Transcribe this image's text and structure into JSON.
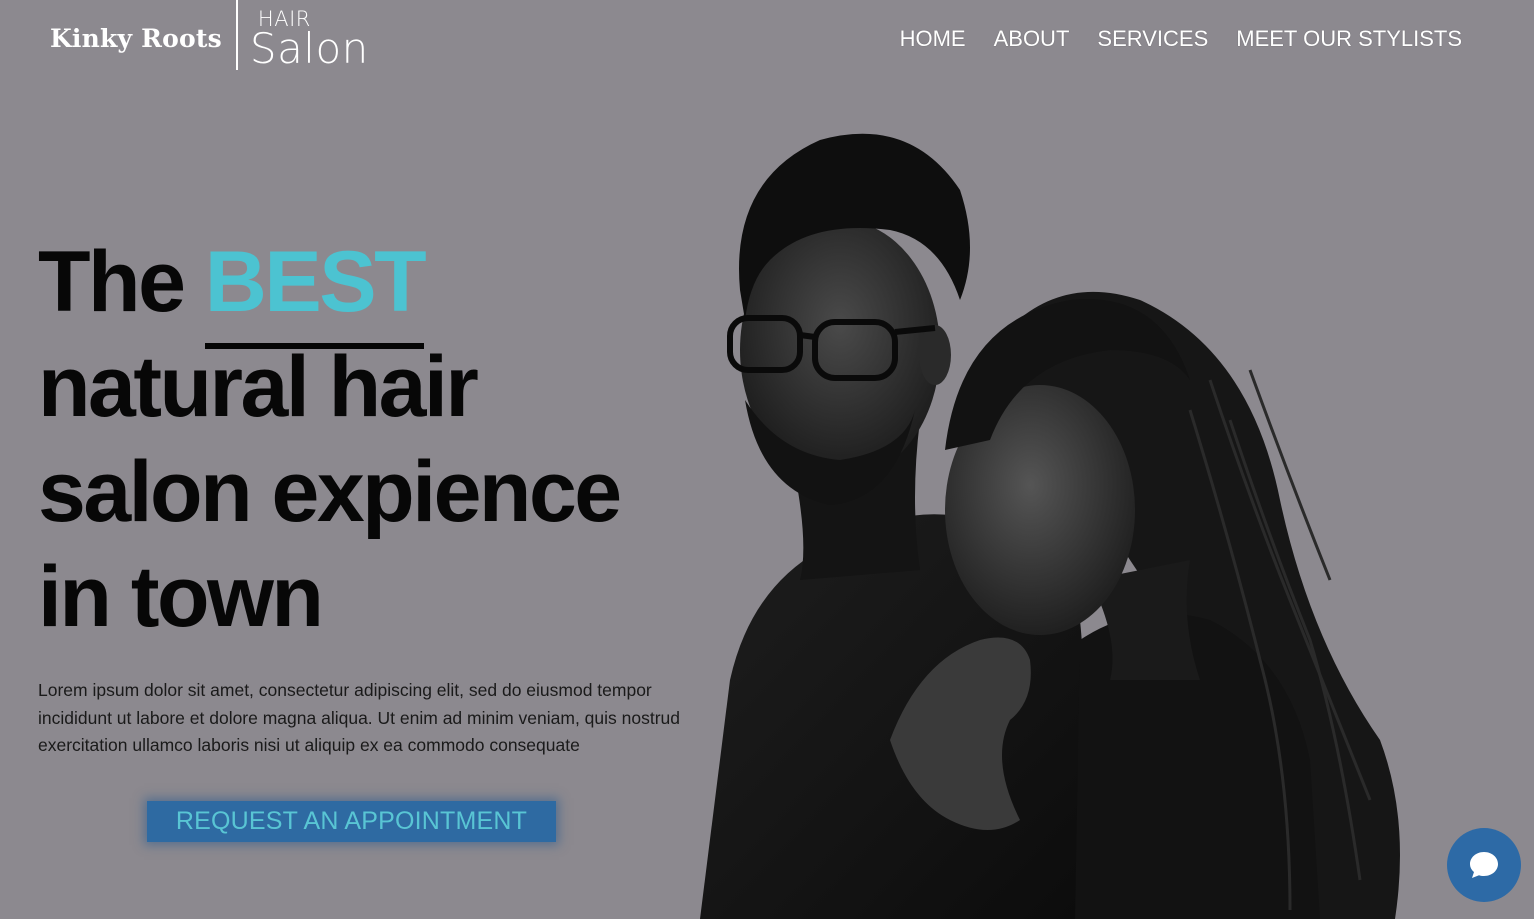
{
  "header": {
    "brand_name": "Kinky Roots",
    "brand_sub_top": "HAIR",
    "brand_sub_bottom": "Salon",
    "nav": [
      {
        "label": "HOME"
      },
      {
        "label": "ABOUT"
      },
      {
        "label": "SERVICES"
      },
      {
        "label": "MEET OUR STYLISTS"
      }
    ]
  },
  "hero": {
    "headline_prefix": "The ",
    "headline_accent": "BEST",
    "headline_line2": "natural hair",
    "headline_line3": "salon expience",
    "headline_line4": "in town",
    "body": "Lorem ipsum dolor sit amet, consectetur adipiscing elit, sed do eiusmod tempor incididunt ut labore et dolore magna aliqua. Ut enim ad minim veniam, quis nostrud exercitation ullamco laboris nisi ut aliquip ex ea commodo consequate",
    "cta_label": "REQUEST AN APPOINTMENT"
  },
  "colors": {
    "background": "#8c898f",
    "accent": "#4cc3d1",
    "button": "#2e6aa2",
    "nav_text": "#ffffff"
  },
  "icons": {
    "chat": "chat-bubble-icon"
  }
}
